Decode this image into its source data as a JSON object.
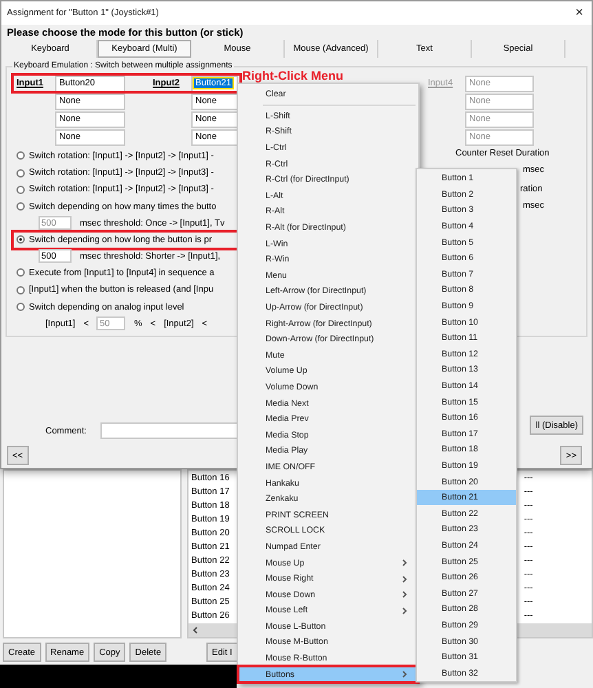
{
  "window": {
    "title": "Assignment for \"Button 1\" (Joystick#1)",
    "close": "×"
  },
  "heading": "Please choose the mode for this button (or stick)",
  "tabs": [
    {
      "label": "Keyboard",
      "selected": false
    },
    {
      "label": "Keyboard (Multi)",
      "selected": true
    },
    {
      "label": "Mouse",
      "selected": false
    },
    {
      "label": "Mouse (Advanced)",
      "selected": false
    },
    {
      "label": "Text",
      "selected": false
    },
    {
      "label": "Special",
      "selected": false
    }
  ],
  "group": {
    "title": "Keyboard Emulation : Switch between multiple assignments",
    "inputs": {
      "annotated": true,
      "columns": [
        {
          "label": "Input1",
          "disabled": false,
          "values": [
            {
              "text": "Button20",
              "selected": false
            },
            {
              "text": "None",
              "selected": false
            },
            {
              "text": "None",
              "selected": false
            },
            {
              "text": "None",
              "selected": false
            }
          ]
        },
        {
          "label": "Input2",
          "disabled": false,
          "values": [
            {
              "text": "Button21",
              "selected": true
            },
            {
              "text": "None",
              "selected": false
            },
            {
              "text": "None",
              "selected": false
            },
            {
              "text": "None",
              "selected": false
            }
          ]
        },
        {
          "label": "Input4",
          "disabled": true,
          "values": [
            {
              "text": "None",
              "selected": false
            },
            {
              "text": "None",
              "selected": false
            },
            {
              "text": "None",
              "selected": false
            },
            {
              "text": "None",
              "selected": false
            }
          ]
        }
      ]
    },
    "options": [
      {
        "kind": "plain",
        "label": "Switch rotation: [Input1] -> [Input2] -> [Input1] -",
        "selected": false,
        "annotated": false
      },
      {
        "kind": "plain",
        "label": "Switch rotation: [Input1] -> [Input2] -> [Input3] -",
        "selected": false,
        "annotated": false
      },
      {
        "kind": "plain",
        "label": "Switch rotation: [Input1] -> [Input2] -> [Input3] -",
        "selected": false,
        "annotated": false
      },
      {
        "kind": "threshold",
        "label": "Switch depending on how many times the butto",
        "selected": false,
        "annotated": false,
        "threshold": {
          "value": "500",
          "disabled": true,
          "text": "msec threshold: Once -> [Input1], Tv"
        }
      },
      {
        "kind": "threshold",
        "label": "Switch depending on how long the button is pr",
        "selected": true,
        "annotated": true,
        "threshold": {
          "value": "500",
          "disabled": false,
          "text": "msec threshold: Shorter -> [Input1],"
        }
      },
      {
        "kind": "plain",
        "label": "Execute from [Input1] to [Input4] in sequence a",
        "selected": false,
        "annotated": false
      },
      {
        "kind": "plain",
        "label": "[Input1] when the button is released (and [Inpu",
        "selected": false,
        "annotated": false
      },
      {
        "kind": "analog",
        "label": "Switch depending on analog input level",
        "selected": false,
        "annotated": false,
        "parts": [
          {
            "kind": "text",
            "text": "[Input1]"
          },
          {
            "kind": "text",
            "text": "<"
          },
          {
            "kind": "field",
            "text": "50",
            "disabled": true
          },
          {
            "kind": "text",
            "text": "%"
          },
          {
            "kind": "text",
            "text": "<"
          },
          {
            "kind": "text",
            "text": "[Input2]"
          },
          {
            "kind": "text",
            "text": "<"
          }
        ]
      }
    ],
    "counter_reset": {
      "title": "Counter Reset Duration",
      "unit": "msec"
    },
    "duration": {
      "text": "ration",
      "unit": "msec"
    }
  },
  "comment": {
    "label": "Comment:"
  },
  "disable_button": "ll (Disable)",
  "prev_button": "<<",
  "next_button": ">>",
  "callout": "Right-Click Menu",
  "background": {
    "left_buttons": [
      "Create",
      "Rename",
      "Copy",
      "Delete"
    ],
    "list_rows": [
      {
        "name": "Button 16",
        "column_2": "---"
      },
      {
        "name": "Button 17",
        "column_2": "---"
      },
      {
        "name": "Button 18",
        "column_2": "---"
      },
      {
        "name": "Button 19",
        "column_2": "---"
      },
      {
        "name": "Button 20",
        "column_2": "---"
      },
      {
        "name": "Button 21",
        "column_2": "---"
      },
      {
        "name": "Button 22",
        "column_2": "---"
      },
      {
        "name": "Button 23",
        "column_2": "---"
      },
      {
        "name": "Button 24",
        "column_2": "---"
      },
      {
        "name": "Button 25",
        "column_2": "---"
      },
      {
        "name": "Button 26",
        "column_2": "---"
      }
    ],
    "edit_button": "Edit I"
  },
  "context_menu": [
    {
      "kind": "item",
      "label": "Clear",
      "selected": false,
      "annotated": false
    },
    {
      "kind": "separator"
    },
    {
      "kind": "item",
      "label": "L-Shift",
      "selected": false,
      "annotated": false
    },
    {
      "kind": "item",
      "label": "R-Shift",
      "selected": false,
      "annotated": false
    },
    {
      "kind": "item",
      "label": "L-Ctrl",
      "selected": false,
      "annotated": false
    },
    {
      "kind": "item",
      "label": "R-Ctrl",
      "selected": false,
      "annotated": false
    },
    {
      "kind": "item",
      "label": "R-Ctrl (for DirectInput)",
      "selected": false,
      "annotated": false
    },
    {
      "kind": "item",
      "label": "L-Alt",
      "selected": false,
      "annotated": false
    },
    {
      "kind": "item",
      "label": "R-Alt",
      "selected": false,
      "annotated": false
    },
    {
      "kind": "item",
      "label": "R-Alt (for DirectInput)",
      "selected": false,
      "annotated": false
    },
    {
      "kind": "item",
      "label": "L-Win",
      "selected": false,
      "annotated": false
    },
    {
      "kind": "item",
      "label": "R-Win",
      "selected": false,
      "annotated": false
    },
    {
      "kind": "item",
      "label": "Menu",
      "selected": false,
      "annotated": false
    },
    {
      "kind": "item",
      "label": "Left-Arrow (for DirectInput)",
      "selected": false,
      "annotated": false
    },
    {
      "kind": "item",
      "label": "Up-Arrow (for DirectInput)",
      "selected": false,
      "annotated": false
    },
    {
      "kind": "item",
      "label": "Right-Arrow (for DirectInput)",
      "selected": false,
      "annotated": false
    },
    {
      "kind": "item",
      "label": "Down-Arrow (for DirectInput)",
      "selected": false,
      "annotated": false
    },
    {
      "kind": "item",
      "label": "Mute",
      "selected": false,
      "annotated": false
    },
    {
      "kind": "item",
      "label": "Volume Up",
      "selected": false,
      "annotated": false
    },
    {
      "kind": "item",
      "label": "Volume Down",
      "selected": false,
      "annotated": false
    },
    {
      "kind": "item",
      "label": "Media Next",
      "selected": false,
      "annotated": false
    },
    {
      "kind": "item",
      "label": "Media Prev",
      "selected": false,
      "annotated": false
    },
    {
      "kind": "item",
      "label": "Media Stop",
      "selected": false,
      "annotated": false
    },
    {
      "kind": "item",
      "label": "Media Play",
      "selected": false,
      "annotated": false
    },
    {
      "kind": "item",
      "label": "IME ON/OFF",
      "selected": false,
      "annotated": false
    },
    {
      "kind": "item",
      "label": "Hankaku",
      "selected": false,
      "annotated": false
    },
    {
      "kind": "item",
      "label": "Zenkaku",
      "selected": false,
      "annotated": false
    },
    {
      "kind": "item",
      "label": "PRINT SCREEN",
      "selected": false,
      "annotated": false
    },
    {
      "kind": "item",
      "label": "SCROLL LOCK",
      "selected": false,
      "annotated": false
    },
    {
      "kind": "item",
      "label": "Numpad Enter",
      "selected": false,
      "annotated": false
    },
    {
      "kind": "submenu",
      "label": "Mouse Up",
      "selected": false,
      "annotated": false
    },
    {
      "kind": "submenu",
      "label": "Mouse Right",
      "selected": false,
      "annotated": false
    },
    {
      "kind": "submenu",
      "label": "Mouse Down",
      "selected": false,
      "annotated": false
    },
    {
      "kind": "submenu",
      "label": "Mouse Left",
      "selected": false,
      "annotated": false
    },
    {
      "kind": "item",
      "label": "Mouse L-Button",
      "selected": false,
      "annotated": false
    },
    {
      "kind": "item",
      "label": "Mouse M-Button",
      "selected": false,
      "annotated": false
    },
    {
      "kind": "item",
      "label": "Mouse R-Button",
      "selected": false,
      "annotated": false
    },
    {
      "kind": "submenu",
      "label": "Buttons",
      "selected": true,
      "annotated": true
    }
  ],
  "submenu": [
    {
      "label": "Button 1",
      "selected": false
    },
    {
      "label": "Button 2",
      "selected": false
    },
    {
      "label": "Button 3",
      "selected": false
    },
    {
      "label": "Button 4",
      "selected": false
    },
    {
      "label": "Button 5",
      "selected": false
    },
    {
      "label": "Button 6",
      "selected": false
    },
    {
      "label": "Button 7",
      "selected": false
    },
    {
      "label": "Button 8",
      "selected": false
    },
    {
      "label": "Button 9",
      "selected": false
    },
    {
      "label": "Button 10",
      "selected": false
    },
    {
      "label": "Button 11",
      "selected": false
    },
    {
      "label": "Button 12",
      "selected": false
    },
    {
      "label": "Button 13",
      "selected": false
    },
    {
      "label": "Button 14",
      "selected": false
    },
    {
      "label": "Button 15",
      "selected": false
    },
    {
      "label": "Button 16",
      "selected": false
    },
    {
      "label": "Button 17",
      "selected": false
    },
    {
      "label": "Button 18",
      "selected": false
    },
    {
      "label": "Button 19",
      "selected": false
    },
    {
      "label": "Button 20",
      "selected": false
    },
    {
      "label": "Button 21",
      "selected": true
    },
    {
      "label": "Button 22",
      "selected": false
    },
    {
      "label": "Button 23",
      "selected": false
    },
    {
      "label": "Button 24",
      "selected": false
    },
    {
      "label": "Button 25",
      "selected": false
    },
    {
      "label": "Button 26",
      "selected": false
    },
    {
      "label": "Button 27",
      "selected": false
    },
    {
      "label": "Button 28",
      "selected": false
    },
    {
      "label": "Button 29",
      "selected": false
    },
    {
      "label": "Button 30",
      "selected": false
    },
    {
      "label": "Button 31",
      "selected": false
    },
    {
      "label": "Button 32",
      "selected": false
    }
  ]
}
